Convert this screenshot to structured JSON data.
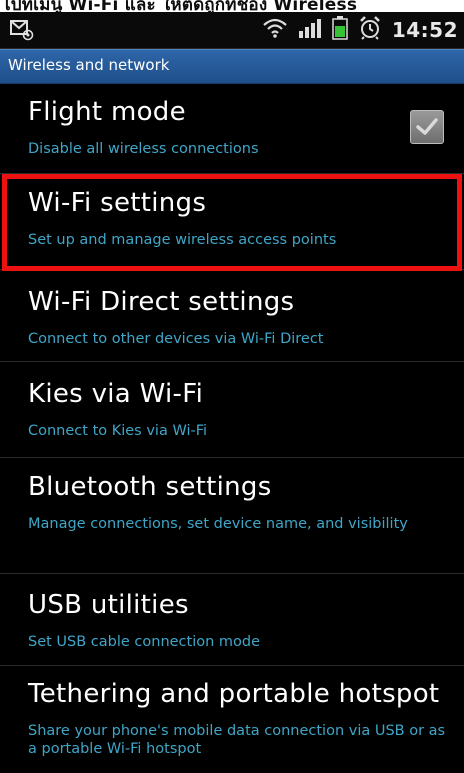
{
  "top_strip": {
    "cut_text": "ไปที่เมนู Wi-Fi และ ให้ติดถูกที่ช่อง Wireless"
  },
  "status_bar": {
    "time": "14:52",
    "icons": [
      "sim-card-icon",
      "wifi-icon",
      "signal-icon",
      "battery-icon",
      "alarm-icon"
    ]
  },
  "category": {
    "title": "Wireless and network"
  },
  "settings": [
    {
      "title": "Flight mode",
      "summary": "Disable all wireless connections",
      "checked": true
    },
    {
      "title": "Wi-Fi settings",
      "summary": "Set up and manage wireless access points",
      "highlighted": true
    },
    {
      "title": "Wi-Fi Direct settings",
      "summary": "Connect to other devices via Wi-Fi Direct"
    },
    {
      "title": "Kies via Wi-Fi",
      "summary": "Connect to Kies via Wi-Fi"
    },
    {
      "title": "Bluetooth settings",
      "summary": "Manage connections, set device name, and visibility"
    },
    {
      "title": "USB utilities",
      "summary": "Set USB cable connection mode"
    },
    {
      "title": "Tethering and portable hotspot",
      "summary": "Share your phone's mobile data connection via USB or as a portable Wi-Fi hotspot"
    }
  ],
  "colors": {
    "background": "#000000",
    "category_bar": "#2a5d9c",
    "summary_text": "#3fa6c8",
    "highlight": "#ee1111"
  }
}
